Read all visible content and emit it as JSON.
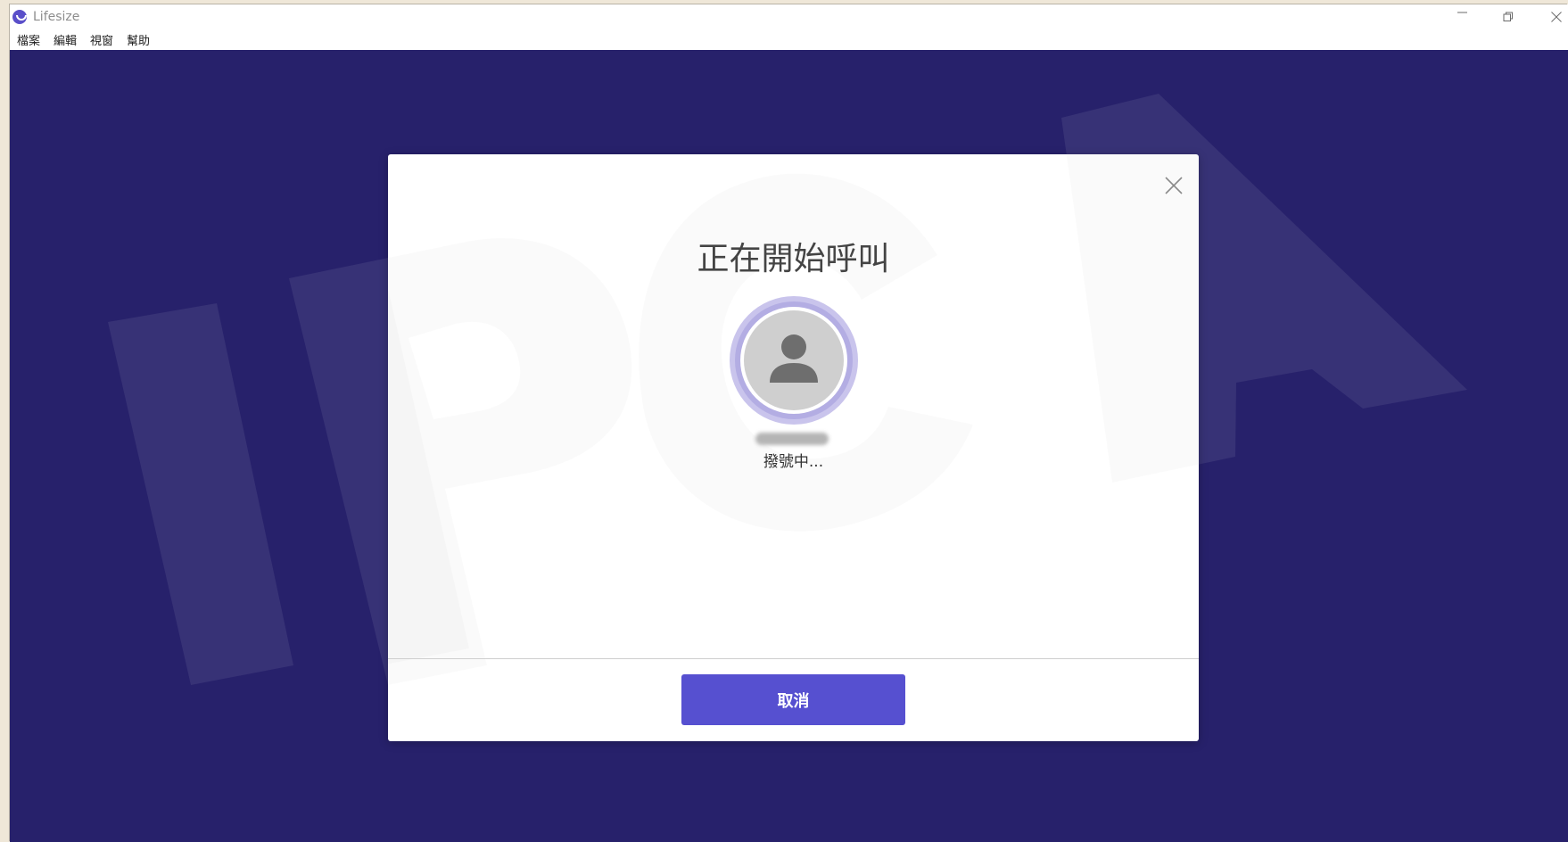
{
  "app": {
    "title": "Lifesize",
    "icon": "lifesize-logo-icon",
    "accent_color": "#5650d0",
    "background_color": "#27216b"
  },
  "window_controls": {
    "minimize_icon": "minimize-icon",
    "restore_icon": "restore-icon",
    "close_icon": "close-icon"
  },
  "menu": {
    "file": "檔案",
    "edit": "編輯",
    "view": "視窗",
    "help": "幫助"
  },
  "watermark": {
    "text": "IPCA"
  },
  "dialog": {
    "title": "正在開始呼叫",
    "avatar_icon": "person-icon",
    "status": "撥號中...",
    "cancel_label": "取消",
    "close_icon": "close-icon"
  }
}
